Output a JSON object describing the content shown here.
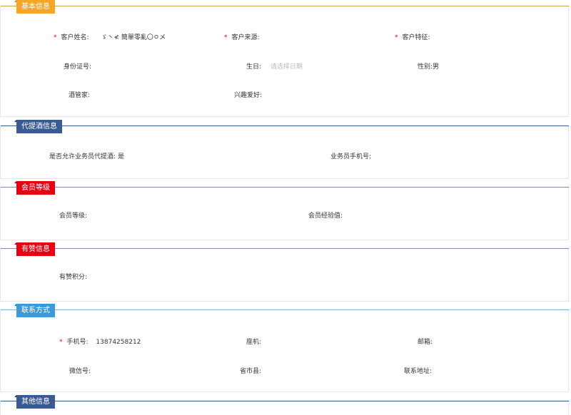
{
  "sections": {
    "basic": {
      "title": "基本信息",
      "color": "#f5a623",
      "fields": {
        "customer_name": {
          "label": "客户姓名:",
          "value": "ゞ丶≮ 簡單零亂〇ㅇメ",
          "required": true
        },
        "customer_source": {
          "label": "客户来源:",
          "value": "",
          "required": true
        },
        "customer_feature": {
          "label": "客户特征:",
          "value": "",
          "required": true
        },
        "id_number": {
          "label": "身份证号:",
          "value": ""
        },
        "birthday": {
          "label": "生日:",
          "placeholder": "请选择日期"
        },
        "gender": {
          "label": "性别:",
          "value": "男"
        },
        "wine_butler": {
          "label": "酒管家:",
          "value": ""
        },
        "hobbies": {
          "label": "兴趣爱好:",
          "value": ""
        }
      }
    },
    "proxy": {
      "title": "代提酒信息",
      "color": "#3a5a94",
      "fields": {
        "allow_proxy": {
          "label": "是否允许业务员代提酒:",
          "value": "是"
        },
        "sales_phone": {
          "label": "业务员手机号:",
          "value": ""
        }
      }
    },
    "member": {
      "title": "会员等级",
      "color": "#e60012",
      "fields": {
        "level": {
          "label": "会员等级:",
          "value": ""
        },
        "exp": {
          "label": "会员经验值:",
          "value": ""
        }
      }
    },
    "youzan": {
      "title": "有赞信息",
      "color": "#e60012",
      "fields": {
        "points": {
          "label": "有赞积分:",
          "value": ""
        }
      }
    },
    "contact": {
      "title": "联系方式",
      "color": "#3d9ad8",
      "fields": {
        "mobile": {
          "label": "手机号:",
          "value": "13874258212",
          "required": true
        },
        "landline": {
          "label": "座机:",
          "value": ""
        },
        "email": {
          "label": "邮箱:",
          "value": ""
        },
        "wechat": {
          "label": "微信号:",
          "value": ""
        },
        "region": {
          "label": "省市县:",
          "value": ""
        },
        "address": {
          "label": "联系地址:",
          "value": ""
        }
      }
    },
    "other": {
      "title": "其他信息",
      "color": "#3a5a94"
    }
  }
}
